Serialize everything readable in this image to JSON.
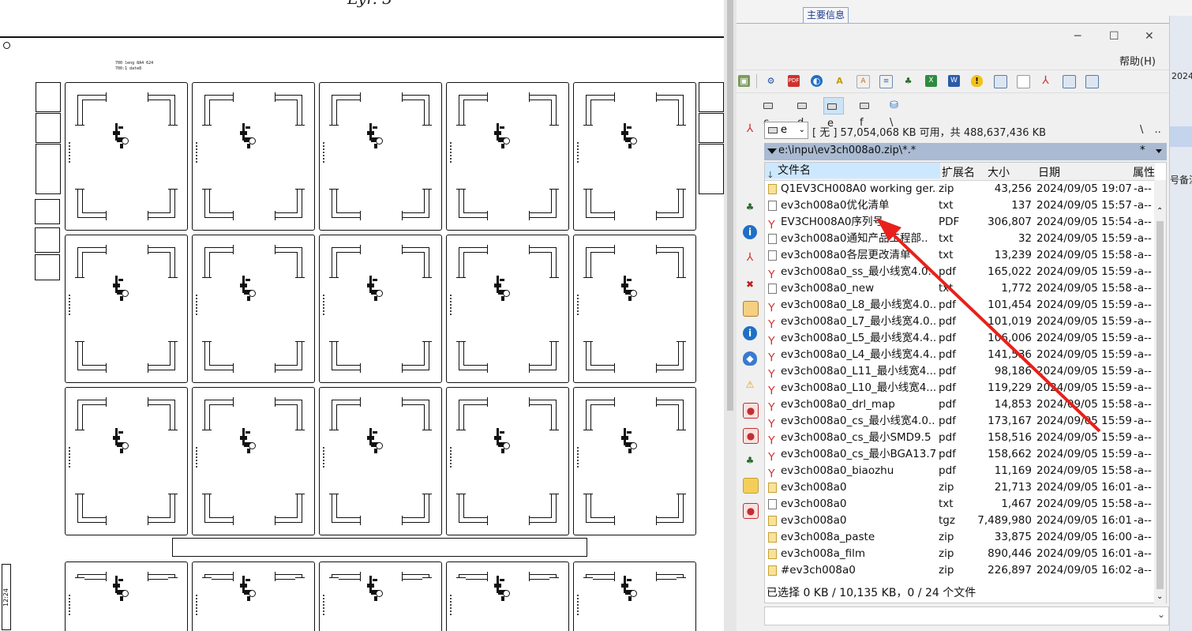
{
  "pcb": {
    "title": "Lyr. 3",
    "header_line1": "700 leng 8A4 624",
    "header_line2": "700:1 date8",
    "time_label": "12:24"
  },
  "bg_window": {
    "tab_label": "主要信息",
    "year_label": "2024",
    "note_label": "号备注"
  },
  "tc": {
    "win_min": "─",
    "win_max": "☐",
    "win_close": "✕",
    "menu_help": "帮助(H)",
    "drives": [
      {
        "label": "c"
      },
      {
        "label": "d"
      },
      {
        "label": "e"
      },
      {
        "label": "f"
      },
      {
        "label": "\\"
      }
    ],
    "drive_select": "e",
    "free_space": "[ 无 ]  57,054,068 KB 可用，共 488,637,436 KB",
    "path_nav_root": "\\",
    "path_nav_up": "..",
    "path": "e:\\inpu\\ev3ch008a0.zip\\*.*",
    "path_star": "*",
    "columns": {
      "name": "文件名",
      "ext": "扩展名",
      "size": "大小",
      "date": "日期",
      "attr": "属性"
    },
    "files": [
      {
        "name": "Q1EV3CH008A0 working ger..",
        "ext": "zip",
        "size": "43,256",
        "date": "2024/09/05 19:07",
        "attr": "-a--",
        "type": "zip"
      },
      {
        "name": "ev3ch008a0优化清单",
        "ext": "txt",
        "size": "137",
        "date": "2024/09/05 15:57",
        "attr": "-a--",
        "type": "txt"
      },
      {
        "name": "EV3CH008A0序列号",
        "ext": "PDF",
        "size": "306,807",
        "date": "2024/09/05 15:54",
        "attr": "-a--",
        "type": "pdf"
      },
      {
        "name": "ev3ch008a0通知产品工程部..",
        "ext": "txt",
        "size": "32",
        "date": "2024/09/05 15:59",
        "attr": "-a--",
        "type": "txt"
      },
      {
        "name": "ev3ch008a0各层更改清单",
        "ext": "txt",
        "size": "13,239",
        "date": "2024/09/05 15:58",
        "attr": "-a--",
        "type": "txt"
      },
      {
        "name": "ev3ch008a0_ss_最小线宽4.0..",
        "ext": "pdf",
        "size": "165,022",
        "date": "2024/09/05 15:59",
        "attr": "-a--",
        "type": "pdf"
      },
      {
        "name": "ev3ch008a0_new",
        "ext": "txt",
        "size": "1,772",
        "date": "2024/09/05 15:58",
        "attr": "-a--",
        "type": "txt"
      },
      {
        "name": "ev3ch008a0_L8_最小线宽4.0..",
        "ext": "pdf",
        "size": "101,454",
        "date": "2024/09/05 15:59",
        "attr": "-a--",
        "type": "pdf"
      },
      {
        "name": "ev3ch008a0_L7_最小线宽4.0..",
        "ext": "pdf",
        "size": "101,019",
        "date": "2024/09/05 15:59",
        "attr": "-a--",
        "type": "pdf"
      },
      {
        "name": "ev3ch008a0_L5_最小线宽4.4..",
        "ext": "pdf",
        "size": "106,006",
        "date": "2024/09/05 15:59",
        "attr": "-a--",
        "type": "pdf"
      },
      {
        "name": "ev3ch008a0_L4_最小线宽4.4..",
        "ext": "pdf",
        "size": "141,536",
        "date": "2024/09/05 15:59",
        "attr": "-a--",
        "type": "pdf"
      },
      {
        "name": "ev3ch008a0_L11_最小线宽4...",
        "ext": "pdf",
        "size": "98,186",
        "date": "2024/09/05 15:59",
        "attr": "-a--",
        "type": "pdf"
      },
      {
        "name": "ev3ch008a0_L10_最小线宽4...",
        "ext": "pdf",
        "size": "119,229",
        "date": "2024/09/05 15:59",
        "attr": "-a--",
        "type": "pdf"
      },
      {
        "name": "ev3ch008a0_drl_map",
        "ext": "pdf",
        "size": "14,853",
        "date": "2024/09/05 15:58",
        "attr": "-a--",
        "type": "pdf"
      },
      {
        "name": "ev3ch008a0_cs_最小线宽4.0..",
        "ext": "pdf",
        "size": "173,167",
        "date": "2024/09/05 15:59",
        "attr": "-a--",
        "type": "pdf"
      },
      {
        "name": "ev3ch008a0_cs_最小SMD9.5",
        "ext": "pdf",
        "size": "158,516",
        "date": "2024/09/05 15:59",
        "attr": "-a--",
        "type": "pdf"
      },
      {
        "name": "ev3ch008a0_cs_最小BGA13.7..",
        "ext": "pdf",
        "size": "158,662",
        "date": "2024/09/05 15:59",
        "attr": "-a--",
        "type": "pdf"
      },
      {
        "name": "ev3ch008a0_biaozhu",
        "ext": "pdf",
        "size": "11,169",
        "date": "2024/09/05 15:58",
        "attr": "-a--",
        "type": "pdf"
      },
      {
        "name": "ev3ch008a0",
        "ext": "zip",
        "size": "21,713",
        "date": "2024/09/05 16:01",
        "attr": "-a--",
        "type": "zip"
      },
      {
        "name": "ev3ch008a0",
        "ext": "txt",
        "size": "1,467",
        "date": "2024/09/05 15:58",
        "attr": "-a--",
        "type": "txt"
      },
      {
        "name": "ev3ch008a0",
        "ext": "tgz",
        "size": "7,489,980",
        "date": "2024/09/05 16:01",
        "attr": "-a--",
        "type": "zip"
      },
      {
        "name": "ev3ch008a_paste",
        "ext": "zip",
        "size": "33,875",
        "date": "2024/09/05 16:00",
        "attr": "-a--",
        "type": "zip"
      },
      {
        "name": "ev3ch008a_film",
        "ext": "zip",
        "size": "890,446",
        "date": "2024/09/05 16:01",
        "attr": "-a--",
        "type": "zip"
      },
      {
        "name": "#ev3ch008a0",
        "ext": "zip",
        "size": "226,897",
        "date": "2024/09/05 16:02",
        "attr": "-a--",
        "type": "zip"
      }
    ],
    "status": "已选择 0 KB / 10,135 KB，0 / 24 个文件"
  },
  "colors": {
    "annotation_arrow": "#e8201b",
    "path_bar": "#a9bad2",
    "name_header": "#cce8ff",
    "active_drive": "#cde4f7"
  },
  "icons": {
    "toolbar": [
      "config-icon",
      "network-icon",
      "pdf-icon",
      "globe-icon",
      "font-icon",
      "text-icon",
      "document-icon",
      "tree-icon",
      "excel-icon",
      "word-icon",
      "shield-icon",
      "window-icon",
      "page-icon",
      "pdf-icon",
      "window-icon",
      "window-icon"
    ],
    "sidebar": [
      "tree-icon",
      "info-icon",
      "pdf-icon",
      "delete-icon",
      "image-icon",
      "info-icon",
      "shield-icon",
      "warning-icon",
      "app-icon",
      "app-icon",
      "tree-icon",
      "folder-icon",
      "app-icon"
    ]
  }
}
